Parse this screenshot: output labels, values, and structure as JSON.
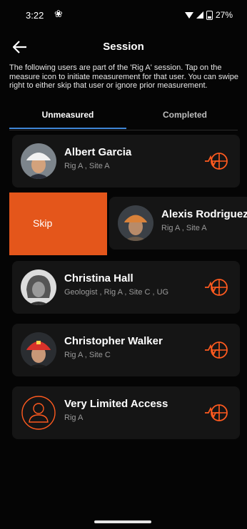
{
  "status_bar": {
    "time": "3:22",
    "battery": "27%"
  },
  "header": {
    "title": "Session"
  },
  "description": "The following users are part of the 'Rig A' session. Tap on the measure icon to initiate measurement for that user. You can swipe right to either skip that user or ignore prior measurement.",
  "tabs": [
    {
      "label": "Unmeasured",
      "active": true
    },
    {
      "label": "Completed",
      "active": false
    }
  ],
  "swipe_action": {
    "label": "Skip",
    "color": "#e4561b"
  },
  "users": [
    {
      "name": "Albert Garcia",
      "details": "Rig A , Site A"
    },
    {
      "name": "Alexis Rodriguez",
      "details": "Rig A , Site A"
    },
    {
      "name": "Christina Hall",
      "details": "Geologist , Rig A , Site C , UG"
    },
    {
      "name": "Christopher Walker",
      "details": "Rig A , Site C"
    },
    {
      "name": "Very Limited Access",
      "details": "Rig A"
    }
  ],
  "colors": {
    "accent": "#ff5a1f",
    "tab_indicator": "#3f86d6",
    "card": "#151515"
  }
}
